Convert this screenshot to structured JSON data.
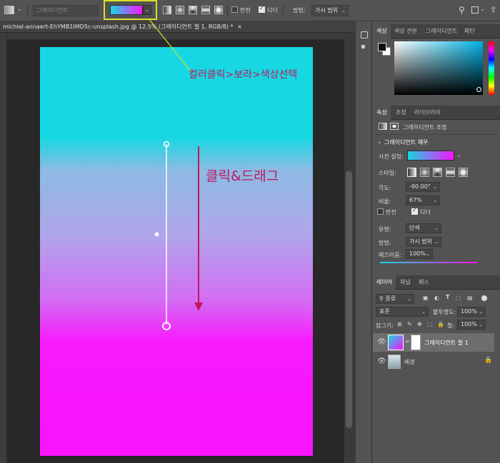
{
  "option_bar": {
    "preset_placeholder": "그레이디언트",
    "reverse_label": "반전",
    "dither_label": "디더",
    "method_label": "방법:",
    "method_value": "가시 범위"
  },
  "document_tab": {
    "title": "michiel-annaert-EhYMB1IMD5c-unsplash.jpg @ 12.5% (그레이디언트 칠 1, RGB/8) *",
    "close": "×"
  },
  "annotations": {
    "color_hint": "컬러클릭>보라>색상선택",
    "drag_hint": "클릭&드래그"
  },
  "color_panel": {
    "tabs": [
      "색상",
      "색상 견본",
      "그레이디언트",
      "패턴"
    ]
  },
  "properties_panel": {
    "tabs": [
      "속성",
      "조정",
      "라이브러리"
    ],
    "layer_type": "그레이디언트 조정",
    "section": "그레이디언트 채우",
    "preset_label": "사전 설정:",
    "style_label": "스타일:",
    "angle_label": "각도:",
    "angle_value": "-90.00°",
    "scale_label": "비율:",
    "scale_value": "67%",
    "reverse_label": "반전",
    "dither_label": "디더",
    "type_label": "유형:",
    "type_value": "단색",
    "method_label": "방법:",
    "method_value": "가시 범위",
    "smooth_label": "매끄러움:",
    "smooth_value": "100%"
  },
  "layers_panel": {
    "tabs": [
      "레이어",
      "채널",
      "패스"
    ],
    "filter_value": "종류",
    "blend_mode": "표준",
    "opacity_label": "불투명도:",
    "opacity_value": "100%",
    "lock_label": "잠그기:",
    "fill_label": "칠:",
    "fill_value": "100%",
    "layers": [
      {
        "name": "그레이디언트 칠 1"
      },
      {
        "name": "배경"
      }
    ]
  },
  "colors": {
    "highlight_box": "#d8df27",
    "annotation": "#c0185f",
    "gradient_start": "#17d7e2",
    "gradient_end": "#f813fd"
  }
}
